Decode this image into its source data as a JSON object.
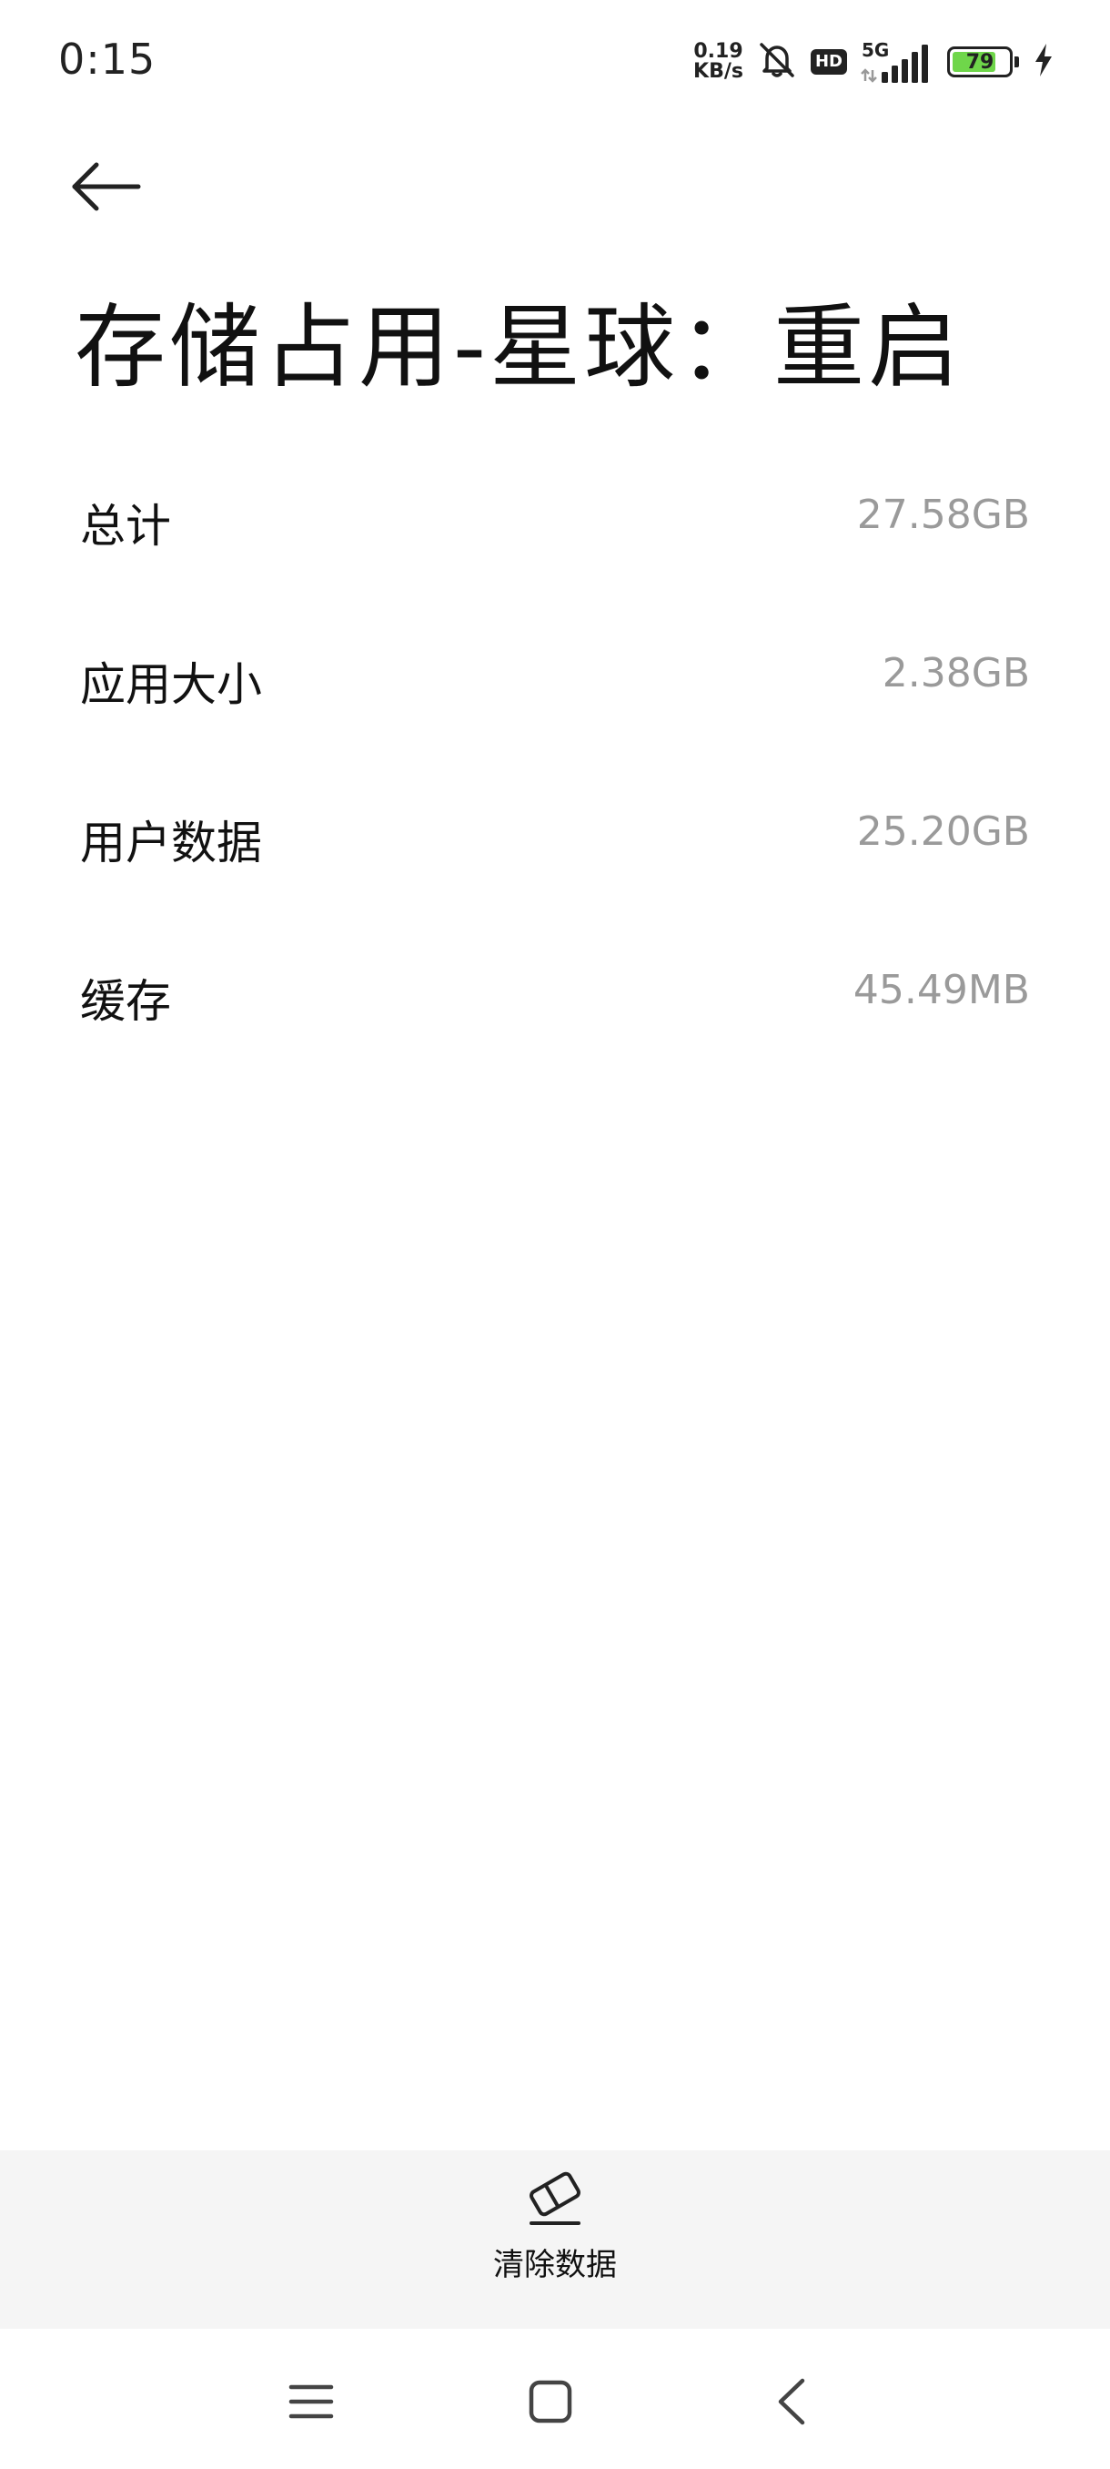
{
  "status_bar": {
    "time": "0:15",
    "net_speed_value": "0.19",
    "net_speed_unit": "KB/s",
    "hd_label": "HD",
    "network_type": "5G",
    "battery_level": "79",
    "battery_fraction": 0.79,
    "battery_fill_color": "#6fd64a",
    "icons": [
      "mute-notifications-icon",
      "hd-icon",
      "signal-icon",
      "battery-icon",
      "charging-icon"
    ]
  },
  "header": {
    "back_icon": "back-arrow-icon",
    "title": "存储占用-星球：重启"
  },
  "storage": {
    "items": [
      {
        "label": "总计",
        "value": "27.58GB"
      },
      {
        "label": "应用大小",
        "value": "2.38GB"
      },
      {
        "label": "用户数据",
        "value": "25.20GB"
      },
      {
        "label": "缓存",
        "value": "45.49MB"
      }
    ]
  },
  "action_bar": {
    "clear_data_icon": "eraser-icon",
    "clear_data_label": "清除数据"
  },
  "nav_bar": {
    "icons": [
      "menu-icon",
      "home-icon",
      "back-icon"
    ]
  }
}
